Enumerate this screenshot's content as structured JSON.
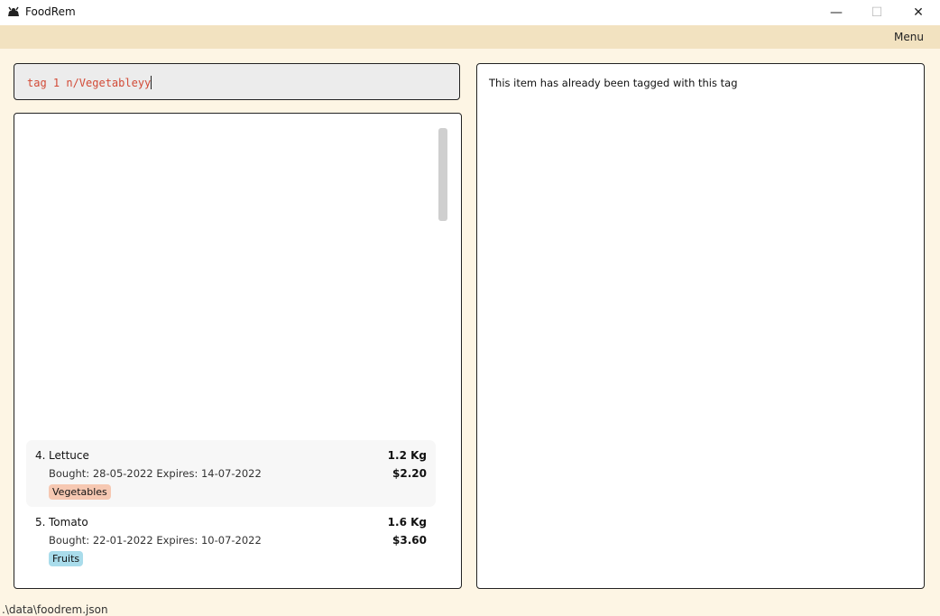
{
  "window": {
    "title": "FoodRem",
    "minimize": "—",
    "maximize": "☐",
    "close": "✕"
  },
  "menubar": {
    "menu_label": "Menu"
  },
  "command": {
    "value": "tag 1 n/Vegetableyy"
  },
  "result": {
    "message": "This item has already been tagged with this tag"
  },
  "items": [
    {
      "index": "4.",
      "name": "Lettuce",
      "bought": "Bought: 28-05-2022",
      "expires": "Expires: 14-07-2022",
      "quantity": "1.2 Kg",
      "price": "$2.20",
      "tag": "Vegetables",
      "tag_color": "#f6c8b2"
    },
    {
      "index": "5.",
      "name": "Tomato",
      "bought": "Bought: 22-01-2022",
      "expires": "Expires: 10-07-2022",
      "quantity": "1.6 Kg",
      "price": "$3.60",
      "tag": "Fruits",
      "tag_color": "#a9dceb"
    }
  ],
  "status": {
    "path": ".\\data\\foodrem.json"
  }
}
